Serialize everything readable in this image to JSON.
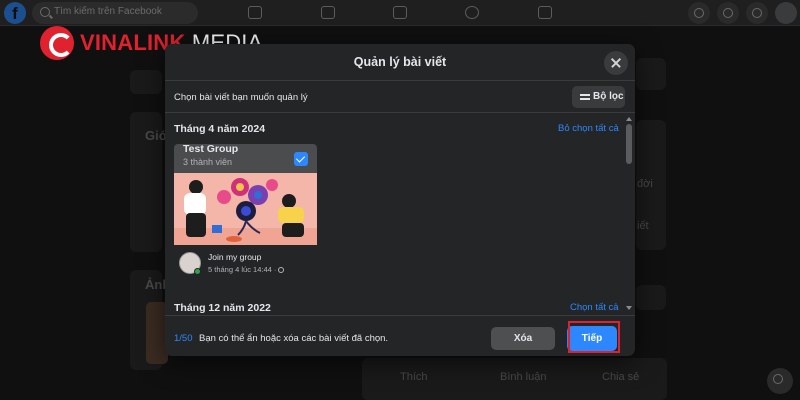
{
  "watermark": {
    "brand_primary": "VINALINK",
    "brand_secondary": "MEDIA",
    "color": "#e0222f"
  },
  "background": {
    "search": {
      "placeholder": "Tìm kiếm trên Facebook"
    },
    "left_items": [
      "Giớ",
      "Ảnh"
    ],
    "right_items": [
      "đời",
      "iết"
    ],
    "actions": {
      "like": "Thích",
      "comment": "Bình luận",
      "share": "Chia sẻ"
    }
  },
  "modal": {
    "title": "Quản lý bài viết",
    "subtitle": "Chọn bài viết bạn muốn quản lý",
    "filter_label": "Bộ lọc",
    "sections": [
      {
        "label": "Tháng 4 năm 2024",
        "action": "Bỏ chọn tất cả"
      },
      {
        "label": "Tháng 12 năm 2022",
        "action": "Chọn tất cả"
      }
    ],
    "post": {
      "group_name": "Test Group",
      "member_count": "3 thành viên",
      "checked": true,
      "author": "Join my group",
      "time": "5 tháng 4 lúc 14:44 ·"
    },
    "footer": {
      "count": "1/50",
      "hint": "Bạn có thể ẩn hoặc xóa các bài viết đã chọn.",
      "delete_label": "Xóa",
      "next_label": "Tiếp"
    }
  },
  "colors": {
    "accent": "#2d88ff",
    "highlight": "#e0222f",
    "modal_bg": "#242526"
  }
}
